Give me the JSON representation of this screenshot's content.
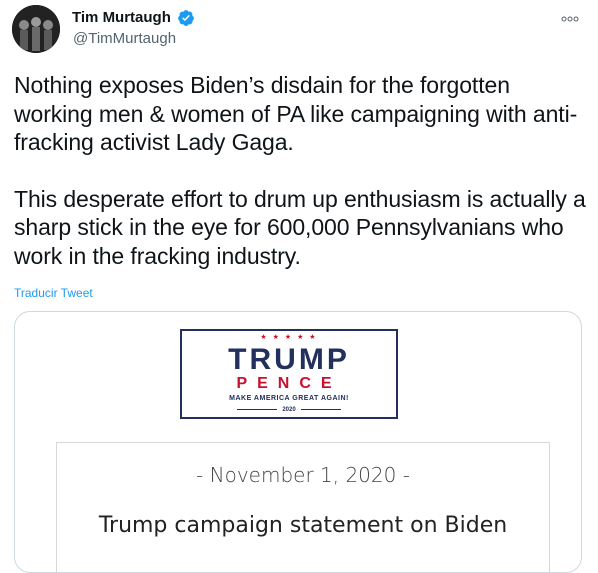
{
  "author": {
    "display_name": "Tim Murtaugh",
    "handle": "@TimMurtaugh",
    "verified": true,
    "avatar_icon": "profile-photo"
  },
  "tweet": {
    "paragraph1": "Nothing exposes Biden’s disdain for the forgotten working men & women of PA like campaigning with anti-fracking activist Lady Gaga.",
    "paragraph2": "This desperate effort to drum up enthusiasm is actually a sharp stick in the eye for 600,000 Pennsylvanians who work in the fracking industry.",
    "translate_label": "Traducir Tweet"
  },
  "media": {
    "logo": {
      "stars": "★ ★ ★ ★ ★",
      "line1": "TRUMP",
      "line2": "PENCE",
      "slogan": "MAKE AMERICA GREAT AGAIN!",
      "year": "2020"
    },
    "statement_date": "- November 1, 2020 -",
    "statement_title": "Trump campaign statement on Biden"
  },
  "colors": {
    "link": "#1d9bf0",
    "verified": "#1d9bf0",
    "logo_navy": "#232f5c",
    "logo_red": "#c8102e"
  }
}
